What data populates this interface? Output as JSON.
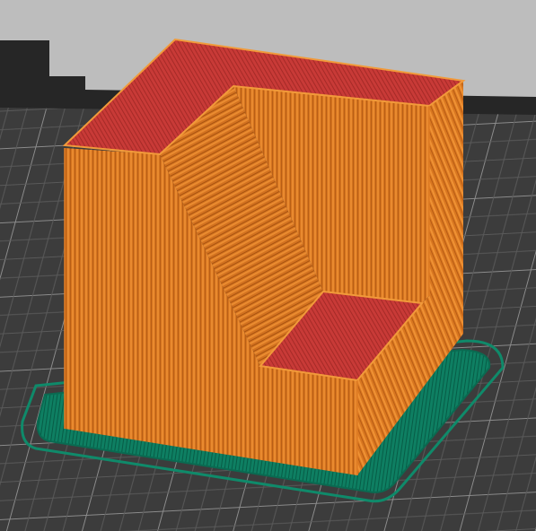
{
  "viewport": {
    "colors": {
      "upper_background": "#bdbdbd",
      "dark_band": "#262626",
      "bed_surface": "#3b3b3b",
      "grid_line": "#9a9a9a",
      "skirt_outline": "#0f8a6a",
      "brim": "#0e7f62",
      "perimeter_orange_light": "#e98a2f",
      "perimeter_orange_dark": "#c86618",
      "top_solid_infill": "#c83a37",
      "top_edge_highlight": "#f19a3a"
    },
    "icons": {
      "skirt": "skirt-outline-icon",
      "brim": "brim-icon"
    }
  }
}
